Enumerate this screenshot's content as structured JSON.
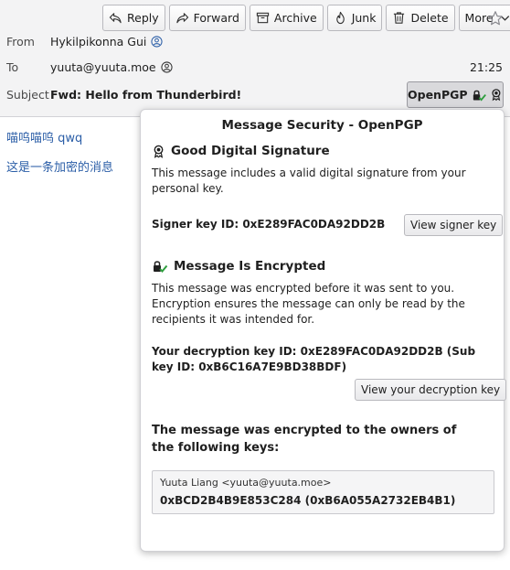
{
  "toolbar": {
    "reply": "Reply",
    "forward": "Forward",
    "archive": "Archive",
    "junk": "Junk",
    "delete": "Delete",
    "more": "More"
  },
  "header": {
    "from_label": "From",
    "from_value": "Hykilpikonna Gui",
    "to_label": "To",
    "to_value": "yuuta@yuuta.moe",
    "time": "21:25",
    "subject_label": "Subject",
    "subject_value": "Fwd: Hello from Thunderbird!",
    "openpgp_label": "OpenPGP"
  },
  "body": {
    "line1": "喵呜喵呜 qwq",
    "line2": "这是一条加密的消息"
  },
  "security": {
    "title": "Message Security - OpenPGP",
    "signature": {
      "heading": "Good Digital Signature",
      "text": "This message includes a valid digital signature from your personal key.",
      "key_id": "Signer key ID: 0xE289FAC0DA92DD2B",
      "button": "View signer key"
    },
    "encryption": {
      "heading": "Message Is Encrypted",
      "text": "This message was encrypted before it was sent to you. Encryption ensures the message can only be read by the recipients it was intended for.",
      "key_id": "Your decryption key ID: 0xE289FAC0DA92DD2B (Sub key ID: 0xB6C16A7E9BD38BDF)",
      "button": "View your decryption key"
    },
    "recipients": {
      "title": "The message was encrypted to the owners of the following keys:",
      "name": "Yuuta Liang <yuuta@yuuta.moe>",
      "key": "0xBCD2B4B9E853C284 (0xB6A055A2732EB4B1)"
    }
  },
  "colors": {
    "link": "#2b5ea7",
    "verified": "#2e9e3e"
  }
}
